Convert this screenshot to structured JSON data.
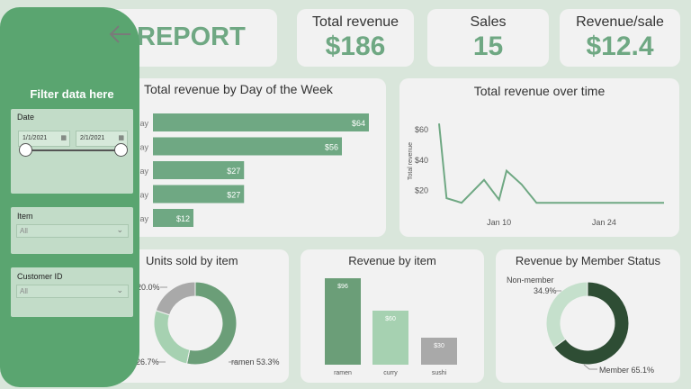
{
  "report_title": "REPORT",
  "kpis": {
    "total_revenue": {
      "label": "Total revenue",
      "value": "$186"
    },
    "sales": {
      "label": "Sales",
      "value": "15"
    },
    "revenue_per_sale": {
      "label": "Revenue/sale",
      "value": "$12.4"
    }
  },
  "sidebar": {
    "title": "Filter data here",
    "date": {
      "label": "Date",
      "start": "1/1/2021",
      "end": "2/1/2021"
    },
    "item": {
      "label": "Item",
      "value": "All"
    },
    "customer": {
      "label": "Customer ID",
      "value": "All"
    }
  },
  "colors": {
    "accent": "#6fa883",
    "sidebar": "#5aa570",
    "background": "#d9e6db",
    "dark_green": "#2e4d34"
  },
  "chart_data": [
    {
      "type": "bar",
      "title": "Total revenue by Day of the Week",
      "categories": [
        "day",
        "day",
        "day",
        "day",
        "day"
      ],
      "values": [
        64,
        56,
        27,
        27,
        12
      ],
      "data_labels": [
        "$64",
        "$56",
        "$27",
        "$27",
        "$12"
      ],
      "xlim": [
        0,
        80
      ]
    },
    {
      "type": "line",
      "title": "Total revenue over time",
      "ylabel": "Total revenue",
      "x": [
        "2021-01-02",
        "2021-01-03",
        "2021-01-05",
        "2021-01-08",
        "2021-01-10",
        "2021-01-11",
        "2021-01-13",
        "2021-01-15",
        "2021-01-20",
        "2021-01-25",
        "2021-02-01"
      ],
      "y": [
        64,
        15,
        12,
        27,
        14,
        33,
        24,
        12,
        12,
        12,
        12
      ],
      "x_ticks": [
        "Jan 10",
        "Jan 24"
      ],
      "y_ticks": [
        "$20",
        "$40",
        "$60"
      ],
      "ylim": [
        5,
        70
      ]
    },
    {
      "type": "pie",
      "title": "Units sold by item",
      "categories": [
        "ramen",
        "curry",
        "sushi"
      ],
      "values": [
        53.3,
        26.7,
        20.0
      ],
      "data_labels": [
        "ramen 53.3%",
        "26.7%",
        "20.0%"
      ],
      "colors": [
        "#6b9e78",
        "#a6d1b1",
        "#a9a9a9"
      ]
    },
    {
      "type": "bar",
      "title": "Revenue by item",
      "categories": [
        "ramen",
        "curry",
        "sushi"
      ],
      "values": [
        96,
        60,
        30
      ],
      "data_labels": [
        "$96",
        "$60",
        "$30"
      ],
      "colors": [
        "#6b9e78",
        "#a6d1b1",
        "#a9a9a9"
      ],
      "ylim": [
        0,
        100
      ]
    },
    {
      "type": "pie",
      "title": "Revenue by Member Status",
      "categories": [
        "Member",
        "Non-member"
      ],
      "values": [
        65.1,
        34.9
      ],
      "data_labels": [
        "Member 65.1%",
        "34.9%"
      ],
      "category_labels": [
        "Member",
        "Non-member"
      ],
      "colors": [
        "#2e4d34",
        "#c5e0cc"
      ]
    }
  ]
}
